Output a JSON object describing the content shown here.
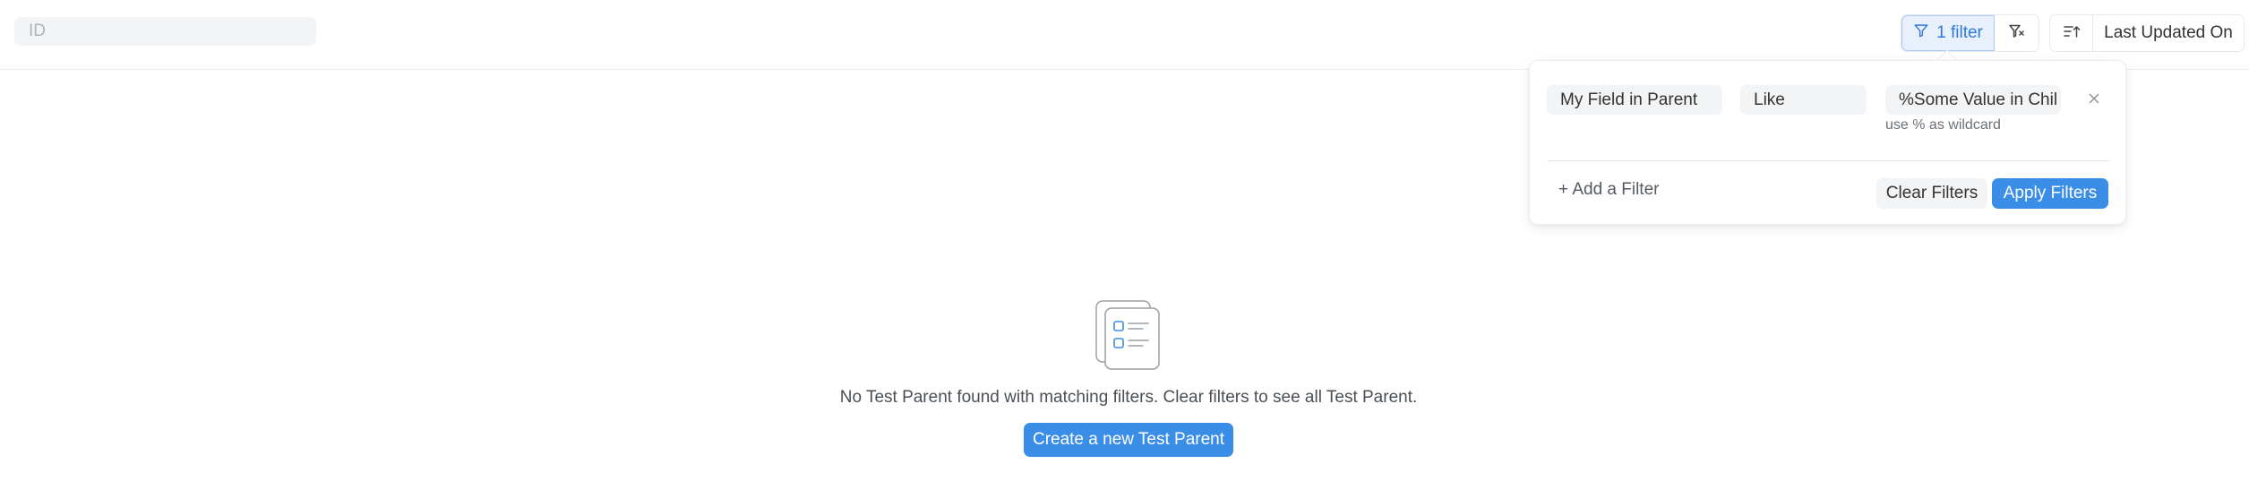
{
  "toolbar": {
    "search": {
      "placeholder": "ID",
      "value": ""
    },
    "filter_button_label": "1 filter",
    "sort_field_label": "Last Updated On"
  },
  "filter_popover": {
    "rows": [
      {
        "field": "My Field in Parent",
        "operator": "Like",
        "value": "%Some Value in Chil",
        "hint": "use % as wildcard"
      }
    ],
    "add_filter_label": "+ Add a Filter",
    "clear_label": "Clear Filters",
    "apply_label": "Apply Filters"
  },
  "empty_state": {
    "message": "No Test Parent found with matching filters. Clear filters to see all Test Parent.",
    "create_label": "Create a new Test Parent"
  },
  "icons": {
    "filter": "funnel-icon",
    "clear_filter": "funnel-x-icon",
    "sort_direction": "sort-ascending-icon",
    "remove": "close-icon",
    "empty": "list-document-icon"
  },
  "colors": {
    "accent": "#3b8ee8",
    "filter_active_bg": "#e8f1fb",
    "filter_active_text": "#2f7ad9",
    "pill_bg": "#f3f4f6"
  }
}
